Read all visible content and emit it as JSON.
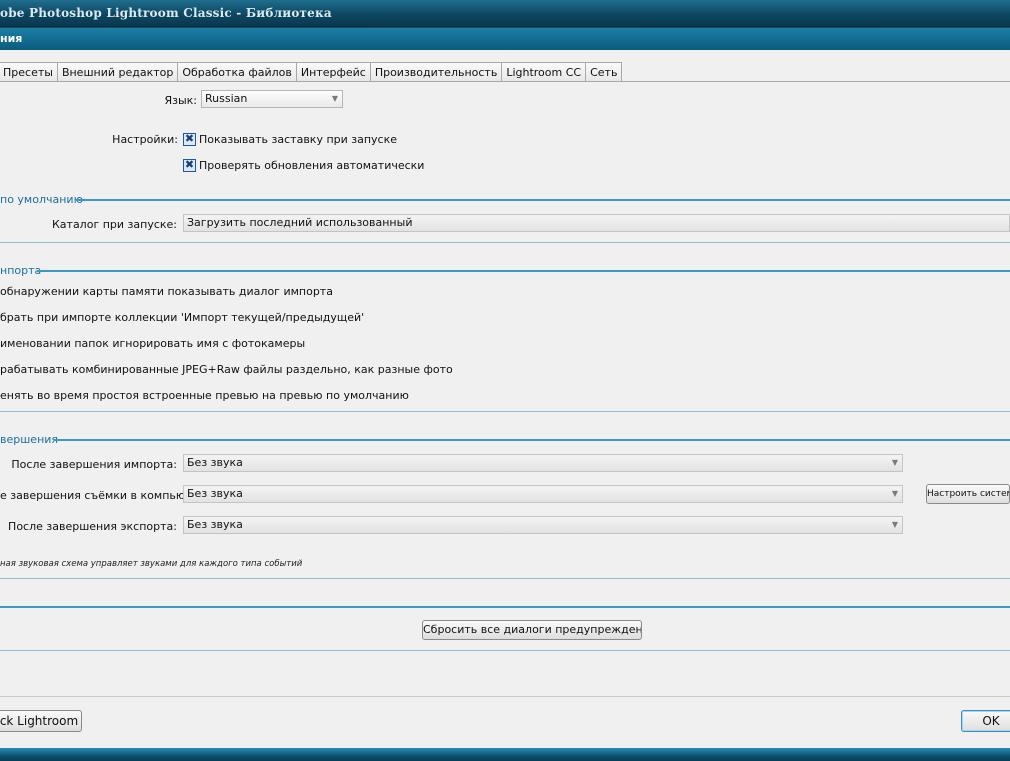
{
  "window": {
    "title": "obe Photoshop Lightroom Classic - Библиотека",
    "dialog_title": "ния"
  },
  "tabs": [
    {
      "label": "Пресеты"
    },
    {
      "label": "Внешний редактор"
    },
    {
      "label": "Обработка файлов"
    },
    {
      "label": "Интерфейс"
    },
    {
      "label": "Производительность"
    },
    {
      "label": "Lightroom CC"
    },
    {
      "label": "Сеть"
    }
  ],
  "language": {
    "label": "Язык:",
    "value": "Russian"
  },
  "settings": {
    "label": "Настройки:",
    "show_splash": {
      "label": "Показывать заставку при запуске",
      "checked": true
    },
    "check_updates": {
      "label": "Проверять обновления автоматически",
      "checked": true
    }
  },
  "default_catalog": {
    "group_title": "по умолчанию",
    "label": "Каталог при запуске:",
    "value": "Загрузить последний использованный"
  },
  "import_options": {
    "group_title": "нпорта",
    "items": [
      {
        "label": "обнаружении карты памяти показывать диалог импорта"
      },
      {
        "label": "брать при импорте коллекции 'Импорт текущей/предыдущей'"
      },
      {
        "label": "именовании папок игнорировать имя с фотокамеры"
      },
      {
        "label": "рабатывать комбинированные JPEG+Raw файлы раздельно, как разные фото"
      },
      {
        "label": "енять во время простоя встроенные превью на превью по умолчанию"
      }
    ]
  },
  "completion_sounds": {
    "group_title": "вершения",
    "import": {
      "label": "После завершения импорта:",
      "value": "Без звука"
    },
    "tether": {
      "label": "е завершения съёмки в компьютер:",
      "value": "Без звука"
    },
    "export": {
      "label": "После завершения экспорта:",
      "value": "Без звука"
    },
    "configure_button": "Настроить систем",
    "note": "ная звуковая схема управляет звуками для каждого типа событий"
  },
  "prompts": {
    "reset_button": "Сбросить все диалоги предупреждения"
  },
  "footer": {
    "left_button": "ck Lightroom",
    "ok_button": "OK"
  },
  "colors": {
    "title_bar": "#0d4660",
    "dialog_title_bar": "#1a7ea6",
    "group_line": "#3c9ac2",
    "group_title": "#1b6ea0",
    "dialog_bg": "#f0f0f0"
  }
}
